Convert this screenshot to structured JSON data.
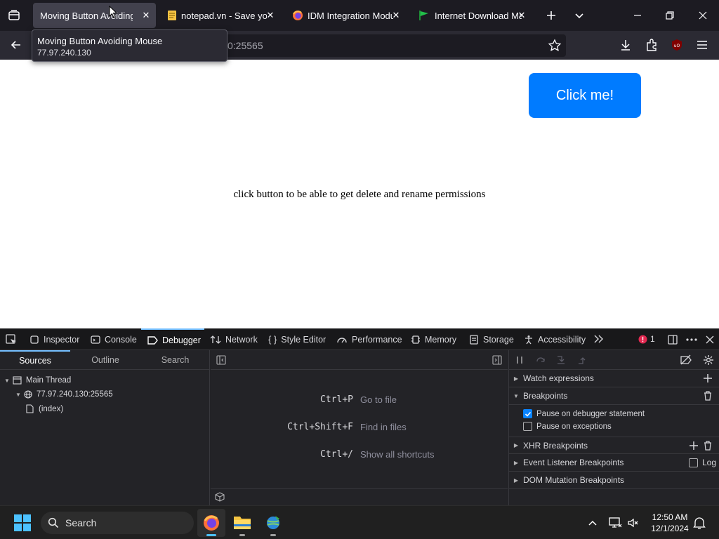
{
  "browser": {
    "tabs": [
      {
        "title": "Moving Button Avoiding Mouse",
        "icon": "none",
        "active": true
      },
      {
        "title": "notepad.vn - Save your notes",
        "icon": "notepad-icon",
        "active": false
      },
      {
        "title": "IDM Integration Module",
        "icon": "firefox-icon",
        "active": false
      },
      {
        "title": "Internet Download Manager",
        "icon": "flag-icon",
        "active": false
      }
    ],
    "close_glyph": "✕",
    "url": "77.97.240.130:25565",
    "url_visible": "0:25565",
    "tooltip": {
      "title": "Moving Button Avoiding Mouse",
      "url": "77.97.240.130"
    }
  },
  "page": {
    "button_label": "Click me!",
    "button_color": "#007bff",
    "message": "click button to be able to get delete and rename permissions"
  },
  "devtools": {
    "tabs": [
      "Inspector",
      "Console",
      "Debugger",
      "Network",
      "Style Editor",
      "Performance",
      "Memory",
      "Storage",
      "Accessibility"
    ],
    "active_tab": "Debugger",
    "error_count": "1",
    "sources_tabs": [
      "Sources",
      "Outline",
      "Search"
    ],
    "tree": {
      "thread": "Main Thread",
      "host": "77.97.240.130:25565",
      "file": "(index)"
    },
    "shortcuts": [
      {
        "key": "Ctrl+P",
        "desc": "Go to file"
      },
      {
        "key": "Ctrl+Shift+F",
        "desc": "Find in files"
      },
      {
        "key": "Ctrl+/",
        "desc": "Show all shortcuts"
      }
    ],
    "panes": {
      "watch": "Watch expressions",
      "breakpoints": "Breakpoints",
      "pause_debugger": "Pause on debugger statement",
      "pause_exceptions": "Pause on exceptions",
      "xhr": "XHR Breakpoints",
      "event_listener": "Event Listener Breakpoints",
      "log": "Log",
      "dom_mutation": "DOM Mutation Breakpoints"
    }
  },
  "taskbar": {
    "search_label": "Search",
    "time": "12:50 AM",
    "date": "12/1/2024"
  }
}
